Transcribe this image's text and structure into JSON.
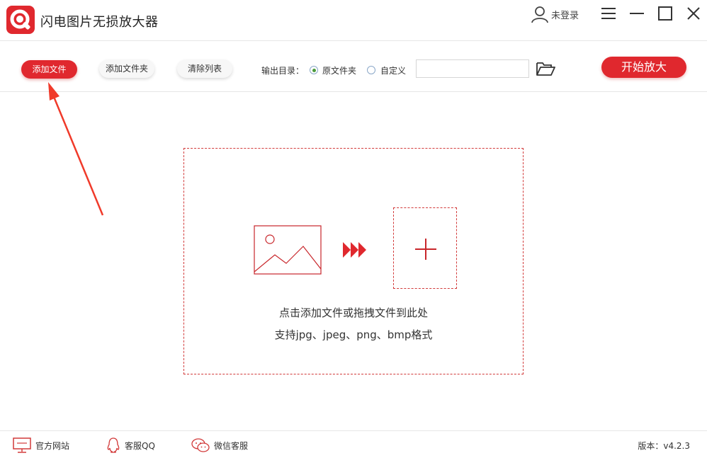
{
  "app": {
    "title": "闪电图片无损放大器"
  },
  "header": {
    "login_label": "未登录"
  },
  "toolbar": {
    "add_file_label": "添加文件",
    "add_folder_label": "添加文件夹",
    "clear_list_label": "清除列表",
    "output_dir_label": "输出目录：",
    "radio_original_label": "原文件夹",
    "radio_custom_label": "自定义",
    "selected_output": "original",
    "output_path_value": "",
    "start_label": "开始放大"
  },
  "drop_zone": {
    "line1": "点击添加文件或拖拽文件到此处",
    "line2": "支持jpg、jpeg、png、bmp格式"
  },
  "footer": {
    "website_label": "官方网站",
    "qq_label": "客服QQ",
    "wechat_label": "微信客服",
    "version_label": "版本：v4.2.3"
  },
  "colors": {
    "accent": "#e0282e",
    "dashed_border": "#d23a3a",
    "annotation_arrow": "#f03a2a"
  },
  "icons": [
    "app-logo-icon",
    "user-icon",
    "menu-icon",
    "minimize-icon",
    "maximize-icon",
    "close-icon",
    "folder-open-icon",
    "image-icon",
    "triple-arrow-icon",
    "plus-icon",
    "monitor-icon",
    "qq-icon",
    "wechat-icon"
  ]
}
